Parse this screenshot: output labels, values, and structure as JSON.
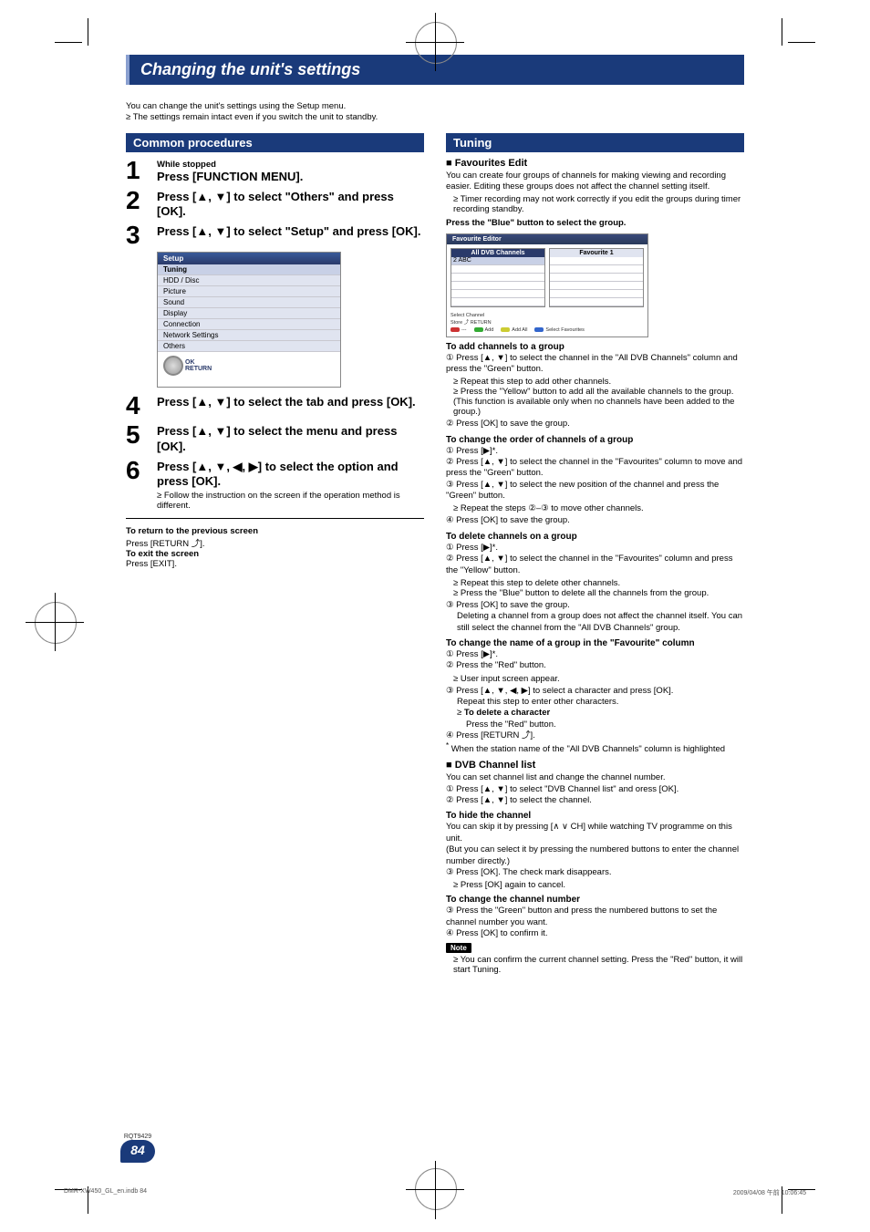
{
  "doc": {
    "title": "Changing the unit's settings",
    "intro_line1": "You can change the unit's settings using the Setup menu.",
    "intro_bullet": "The settings remain intact even if you switch the unit to standby.",
    "return_heading": "To return to the previous screen",
    "return_body": "Press [RETURN ⤴].",
    "exit_heading": "To exit the screen",
    "exit_body": "Press [EXIT].",
    "rqt": "RQT9429",
    "page_num": "84",
    "footer_left": "DMR-XW450_GL_en.indb   84",
    "footer_right": "2009/04/08   午前 10:06:45"
  },
  "left": {
    "section": "Common procedures",
    "steps": {
      "1_small": "While stopped",
      "1_bold": "Press [FUNCTION MENU].",
      "2_bold": "Press [▲, ▼] to select \"Others\" and press [OK].",
      "3_bold": "Press [▲, ▼] to select \"Setup\" and press [OK].",
      "4_bold": "Press [▲, ▼] to select the tab and press [OK].",
      "5_bold": "Press [▲, ▼] to select the menu and press [OK].",
      "6_bold": "Press [▲, ▼, ◀, ▶] to select the option and press [OK].",
      "6_note": "Follow the instruction on the screen if the operation method is different."
    },
    "setup_panel": {
      "title": "Setup",
      "rows": [
        "Tuning",
        "HDD / Disc",
        "Picture",
        "Sound",
        "Display",
        "Connection",
        "Network Settings",
        "Others"
      ],
      "ok": "OK",
      "return": "RETURN"
    }
  },
  "right": {
    "section": "Tuning",
    "fav": {
      "heading": "Favourites Edit",
      "body1": "You can create four groups of channels for making viewing and recording easier. Editing these groups does not affect the channel setting itself.",
      "bullet1": "Timer recording may not work correctly if you edit the groups during timer recording standby.",
      "press_blue": "Press the \"Blue\" button to select the group.",
      "editor": {
        "title": "Favourite Editor",
        "left_hdr": "All DVB Channels",
        "left_row": "2 ABC",
        "right_hdr": "Favourite 1",
        "footer_line1": "Select Channel",
        "footer_line2": "Store ⤴ RETURN",
        "btn_red": "---",
        "btn_green": "Add",
        "btn_yellow": "Add All",
        "btn_blue": "Select Favourites"
      },
      "add": {
        "heading": "To add channels to a group",
        "step1": "Press [▲, ▼] to select the channel in the \"All DVB Channels\" column and press the \"Green\" button.",
        "b1": "Repeat this step to add other channels.",
        "b2": "Press the \"Yellow\" button to add all the available channels to the group. (This function is available only when no channels have been added to the group.)",
        "step2": "Press [OK] to save the group."
      },
      "order": {
        "heading": "To change the order of channels of a group",
        "s1": "Press [▶]*.",
        "s2": "Press [▲, ▼] to select the channel in the \"Favourites\" column to move and press the \"Green\" button.",
        "s3": "Press [▲, ▼] to select the new position of the channel and press the \"Green\" button.",
        "b1": "Repeat the steps ②–③ to move other channels.",
        "s4": "Press [OK] to save the group."
      },
      "del": {
        "heading": "To delete channels on a group",
        "s1": "Press [▶]*.",
        "s2": "Press [▲, ▼] to select the channel in the \"Favourites\" column and press the \"Yellow\" button.",
        "b1": "Repeat this step to delete other channels.",
        "b2": "Press the \"Blue\" button to delete all the channels from the group.",
        "s3": "Press [OK] to save the group.",
        "s3b": "Deleting a channel from a group does not affect the channel itself. You can still select the channel from the \"All DVB Channels\" group."
      },
      "rename": {
        "heading": "To change the name of a group in the \"Favourite\" column",
        "s1": "Press [▶]*.",
        "s2": "Press the \"Red\" button.",
        "b1": "User input screen appear.",
        "s3": "Press [▲, ▼, ◀, ▶] to select a character and press [OK].",
        "s3b": "Repeat this step to enter other characters.",
        "del_bold": "To delete a character",
        "del_body": "Press the \"Red\" button.",
        "s4": "Press [RETURN ⤴].",
        "ast": "When the station name of the \"All DVB Channels\" column is highlighted"
      }
    },
    "dvb": {
      "heading": "DVB Channel list",
      "body": "You can set channel list and change the channel number.",
      "s1": "Press [▲, ▼] to select \"DVB Channel list\" and oress [OK].",
      "s2": "Press [▲, ▼] to select the channel.",
      "hide": {
        "heading": "To hide the channel",
        "body1": "You can skip it by pressing [∧ ∨ CH] while watching TV programme on this unit.",
        "body2": "(But you can select it by pressing the numbered buttons to enter the channel number directly.)",
        "s3": "Press [OK]. The check mark disappears.",
        "b1": "Press [OK] again to cancel."
      },
      "chnum": {
        "heading": "To change the channel number",
        "s3": "Press the \"Green\" button and press the numbered buttons to set the channel number you want.",
        "s4": "Press [OK] to confirm it."
      },
      "note_label": "Note",
      "note_body": "You can confirm the current channel setting. Press the \"Red\" button, it will start Tuning."
    }
  }
}
